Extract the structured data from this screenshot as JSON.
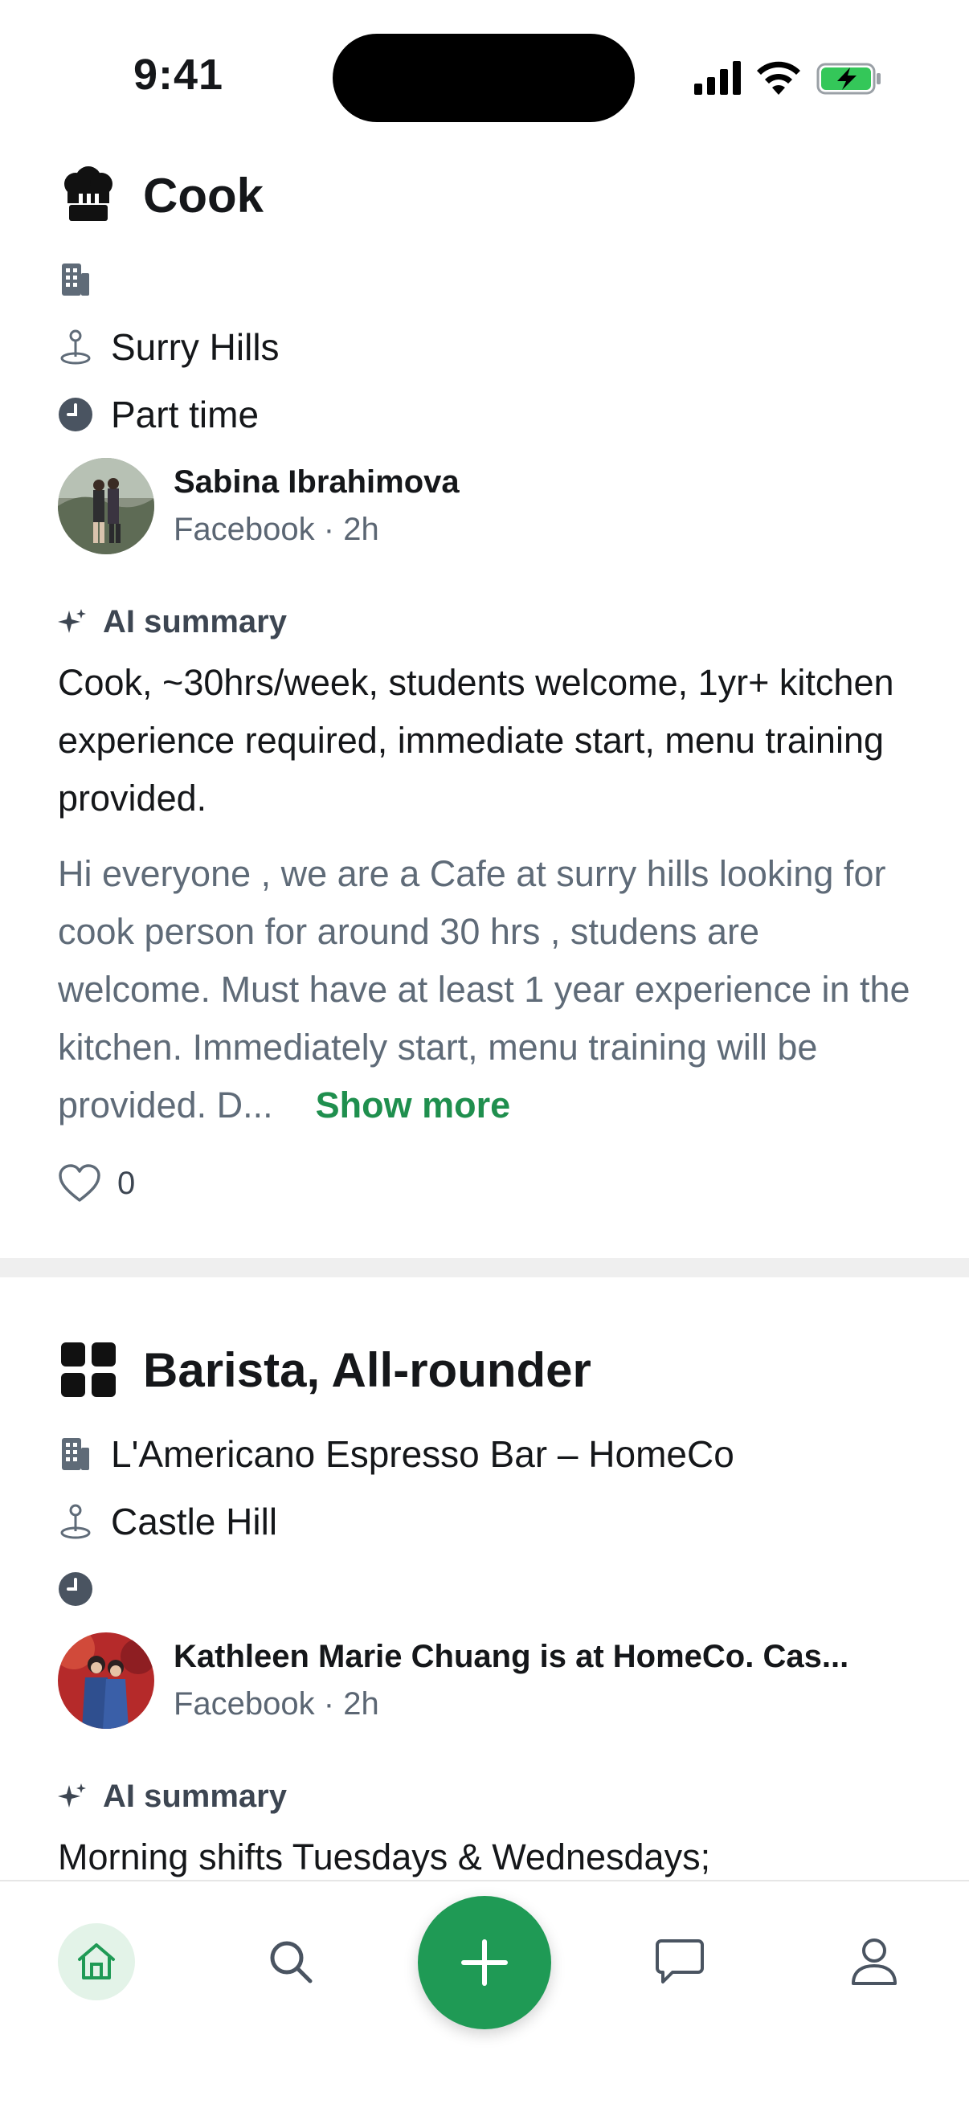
{
  "status": {
    "time": "9:41"
  },
  "posts": [
    {
      "title": "Cook",
      "company": "",
      "location": "Surry Hills",
      "job_type": "Part time",
      "author": "Sabina Ibrahimova",
      "source": "Facebook · 2h",
      "ai_label": "AI summary",
      "ai_summary": "Cook, ~30hrs/week, students welcome, 1yr+ kitchen experience required, immediate start, menu training provided.",
      "body": "Hi everyone , we are a Cafe at surry hills looking for cook person for around 30 hrs , studens are welcome. Must have at least 1 year experience in the kitchen. Immediately start, menu training will be provided. D...",
      "show_more": "Show more",
      "likes": "0"
    },
    {
      "title": "Barista, All-rounder",
      "company": "L'Americano Espresso Bar – HomeCo",
      "location": "Castle Hill",
      "job_type": "",
      "author": "Kathleen Marie Chuang is at HomeCo. Cas...",
      "source": "Facebook · 2h",
      "ai_label": "AI summary",
      "ai_summary": "Morning shifts Tuesdays & Wednesdays;"
    }
  ],
  "nav": {
    "items": [
      "home",
      "search",
      "add",
      "messages",
      "profile"
    ],
    "accent": "#1f9a55"
  }
}
